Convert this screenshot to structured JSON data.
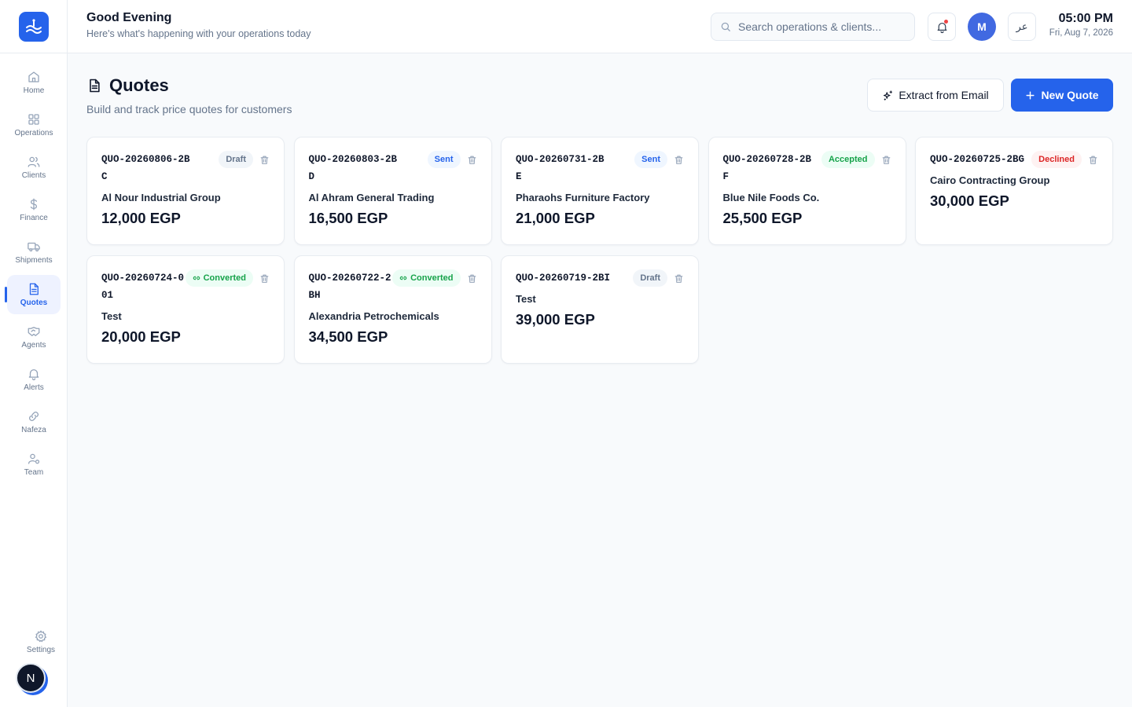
{
  "header": {
    "greeting": "Good Evening",
    "subtitle": "Here's what's happening with your operations today",
    "search_placeholder": "Search operations & clients...",
    "user_initial": "M",
    "lang_label": "عر",
    "time": "05:00 PM",
    "date": "Fri, Aug 7, 2026"
  },
  "sidebar": {
    "items": [
      {
        "label": "Home",
        "icon": "home-icon"
      },
      {
        "label": "Operations",
        "icon": "grid-icon"
      },
      {
        "label": "Clients",
        "icon": "users-icon"
      },
      {
        "label": "Finance",
        "icon": "dollar-icon"
      },
      {
        "label": "Shipments",
        "icon": "truck-icon"
      },
      {
        "label": "Quotes",
        "icon": "document-icon",
        "active": true
      },
      {
        "label": "Agents",
        "icon": "handshake-icon"
      },
      {
        "label": "Alerts",
        "icon": "bell-icon"
      },
      {
        "label": "Nafeza",
        "icon": "link-icon"
      },
      {
        "label": "Team",
        "icon": "team-icon"
      }
    ],
    "settings_label": "Settings",
    "bottom_avatar": "N"
  },
  "page": {
    "title": "Quotes",
    "subtitle": "Build and track price quotes for customers",
    "extract_label": "Extract from Email",
    "new_label": "New Quote"
  },
  "colors": {
    "accent": "#2563eb",
    "draft": "#64748b",
    "sent": "#2563eb",
    "accepted": "#16a34a",
    "declined": "#dc2626",
    "converted": "#16a34a"
  },
  "quotes": [
    {
      "id": "QUO-20260806-2BC",
      "status": "Draft",
      "client": "Al Nour Industrial Group",
      "amount": "12,000 EGP"
    },
    {
      "id": "QUO-20260803-2BD",
      "status": "Sent",
      "client": "Al Ahram General Trading",
      "amount": "16,500 EGP"
    },
    {
      "id": "QUO-20260731-2BE",
      "status": "Sent",
      "client": "Pharaohs Furniture Factory",
      "amount": "21,000 EGP"
    },
    {
      "id": "QUO-20260728-2BF",
      "status": "Accepted",
      "client": "Blue Nile Foods Co.",
      "amount": "25,500 EGP"
    },
    {
      "id": "QUO-20260725-2BG",
      "status": "Declined",
      "client": "Cairo Contracting Group",
      "amount": "30,000 EGP"
    },
    {
      "id": "QUO-20260724-001",
      "status": "Converted",
      "client": "Test",
      "amount": "20,000 EGP"
    },
    {
      "id": "QUO-20260722-2BH",
      "status": "Converted",
      "client": "Alexandria Petrochemicals",
      "amount": "34,500 EGP"
    },
    {
      "id": "QUO-20260719-2BI",
      "status": "Draft",
      "client": "Test",
      "amount": "39,000 EGP"
    }
  ]
}
